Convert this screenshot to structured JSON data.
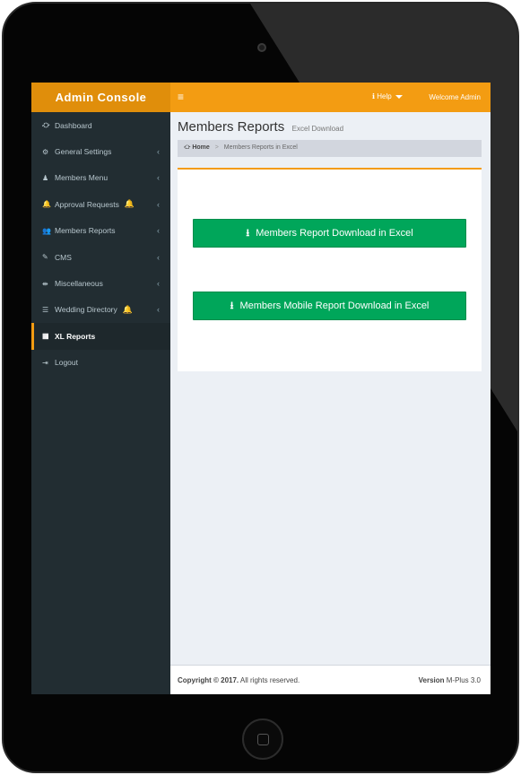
{
  "header": {
    "logo": "Admin Console",
    "toggle_icon": "≡",
    "help_label": "Help",
    "help_icon": "ℹ",
    "welcome": "Welcome Admin"
  },
  "sidebar": {
    "items": [
      {
        "label": "Dashboard",
        "icon": "⛮",
        "icon_name": "dashboard-icon",
        "chevron": "",
        "bell": "",
        "active": false
      },
      {
        "label": "General Settings",
        "icon": "⚙",
        "icon_name": "cogs-icon",
        "chevron": "‹",
        "bell": "",
        "active": false
      },
      {
        "label": "Members Menu",
        "icon": "♟",
        "icon_name": "user-icon",
        "chevron": "‹",
        "bell": "",
        "active": false
      },
      {
        "label": "Approval Requests",
        "icon": "🔔",
        "icon_name": "bell-icon",
        "chevron": "‹",
        "bell": "🔔",
        "active": false
      },
      {
        "label": "Members Reports",
        "icon": "👥",
        "icon_name": "users-icon",
        "chevron": "‹",
        "bell": "",
        "active": false
      },
      {
        "label": "CMS",
        "icon": "✎",
        "icon_name": "edit-icon",
        "chevron": "‹",
        "bell": "",
        "active": false
      },
      {
        "label": "Miscellaneous",
        "icon": "⇼",
        "icon_name": "signpost-icon",
        "chevron": "‹",
        "bell": "",
        "active": false
      },
      {
        "label": "Wedding Directory",
        "icon": "☰",
        "icon_name": "list-icon",
        "chevron": "‹",
        "bell": "🔔",
        "active": false
      },
      {
        "label": "XL Reports",
        "icon": "▦",
        "icon_name": "excel-icon",
        "chevron": "",
        "bell": "",
        "active": true
      },
      {
        "label": "Logout",
        "icon": "⇥",
        "icon_name": "logout-icon",
        "chevron": "",
        "bell": "",
        "active": false
      }
    ]
  },
  "main": {
    "title": "Members Reports",
    "subtitle": "Excel Download",
    "breadcrumb_home": "Home",
    "breadcrumb_sep": ">",
    "breadcrumb_current": "Members Reports in Excel",
    "buttons": [
      {
        "label": "Members Report Download in Excel",
        "icon": "⭳"
      },
      {
        "label": "Members Mobile Report Download in Excel",
        "icon": "⭳"
      }
    ]
  },
  "footer": {
    "copyright_bold": "Copyright © 2017.",
    "copyright_rest": " All rights reserved.",
    "version_bold": "Version",
    "version_rest": " M-Plus 3.0"
  },
  "colors": {
    "accent": "#f39c12",
    "sidebar": "#222d32",
    "button": "#00a65a"
  }
}
